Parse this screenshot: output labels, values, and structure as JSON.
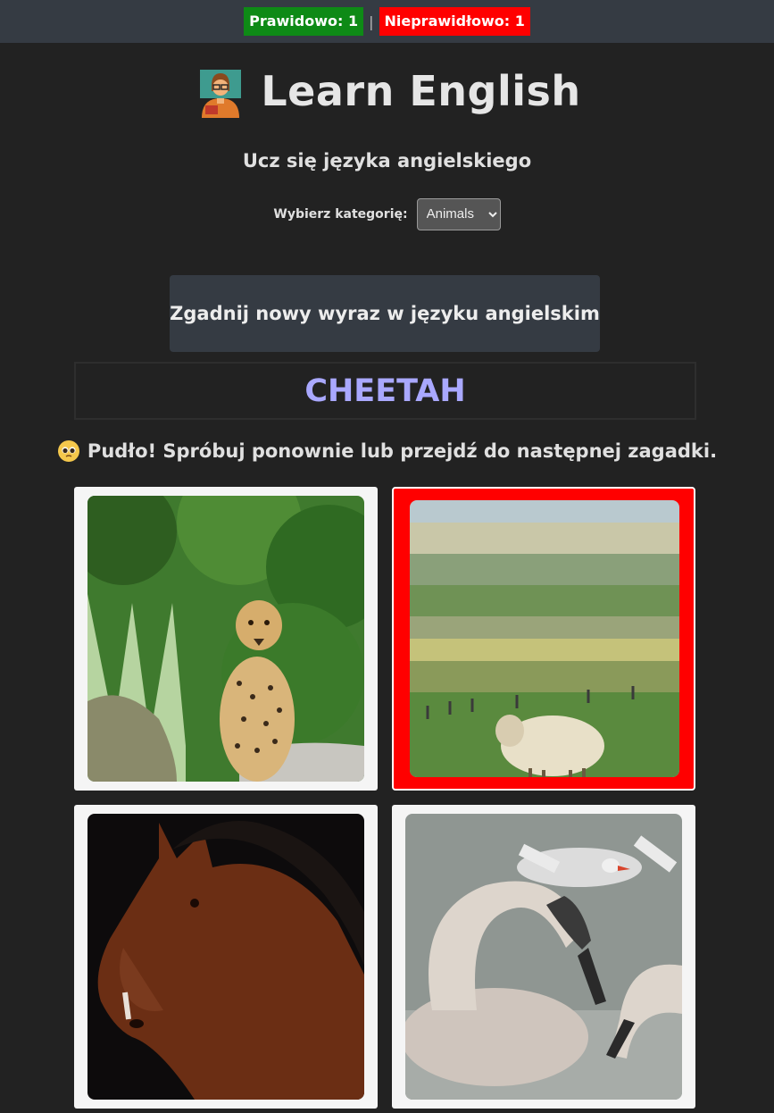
{
  "score": {
    "correct_label": "Prawidowo: 1",
    "separator": "|",
    "wrong_label": "Nieprawidłowo: 1",
    "correct_color": "#0e8a16",
    "wrong_color": "#ff0000"
  },
  "header": {
    "title": "Learn English",
    "title_icon": "teacher-emoji-icon",
    "subtitle": "Ucz się języka angielskiego"
  },
  "category": {
    "label": "Wybierz kategorię:",
    "selected": "Animals"
  },
  "new_word_button": "Zgadnij nowy wyraz w języku angielskim",
  "word": "CHEETAH",
  "feedback": {
    "icon": "pleading-face-icon",
    "text": "Pudło! Spróbuj ponownie lub przejdź do następnej zagadki."
  },
  "options": [
    {
      "image": "cheetah-photo",
      "state": "neutral"
    },
    {
      "image": "sheep-photo",
      "state": "wrong"
    },
    {
      "image": "horse-photo",
      "state": "neutral"
    },
    {
      "image": "swan-photo",
      "state": "neutral"
    }
  ],
  "colors": {
    "background": "#222222",
    "bar": "#353b43",
    "word": "#a9a8ff",
    "wrong_border": "#ff0000"
  }
}
